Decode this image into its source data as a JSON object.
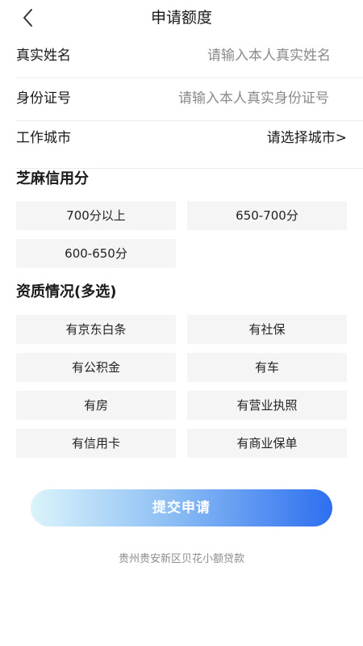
{
  "header": {
    "title": "申请额度",
    "back_icon": "chevron-left-icon"
  },
  "form": {
    "name": {
      "label": "真实姓名",
      "placeholder": "请输入本人真实姓名"
    },
    "id_number": {
      "label": "身份证号",
      "placeholder": "请输入本人真实身份证号"
    },
    "city": {
      "label": "工作城市",
      "value": "请选择城市>"
    }
  },
  "credit_score": {
    "title": "芝麻信用分",
    "options": [
      "700分以上",
      "650-700分",
      "600-650分"
    ]
  },
  "qualifications": {
    "title": "资质情况(多选)",
    "options": [
      "有京东白条",
      "有社保",
      "有公积金",
      "有车",
      "有房",
      "有营业执照",
      "有信用卡",
      "有商业保单"
    ]
  },
  "submit": {
    "label": "提交申请"
  },
  "footer": {
    "text": "贵州贵安新区贝花小额贷款"
  },
  "colors": {
    "button_gradient_start": "#dbf4fb",
    "button_gradient_end": "#2d6ff0",
    "chip_background": "#f5f5f5"
  }
}
